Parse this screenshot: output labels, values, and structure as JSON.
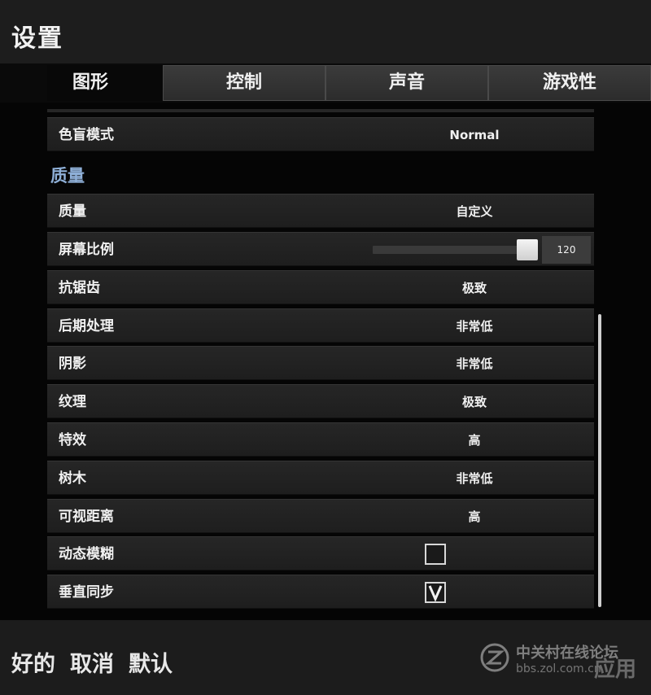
{
  "window": {
    "title": "设置"
  },
  "tabs": [
    {
      "label": "图形",
      "active": true
    },
    {
      "label": "控制",
      "active": false
    },
    {
      "label": "声音",
      "active": false
    },
    {
      "label": "游戏性",
      "active": false
    }
  ],
  "settings": {
    "colorblind": {
      "label": "色盲模式",
      "value": "Normal"
    },
    "quality_section_title": "质量",
    "quality": {
      "label": "质量",
      "value": "自定义"
    },
    "screen_scale": {
      "label": "屏幕比例",
      "value": "120",
      "fill_fraction": 0.93
    },
    "anti_aliasing": {
      "label": "抗锯齿",
      "value": "极致"
    },
    "post_processing": {
      "label": "后期处理",
      "value": "非常低"
    },
    "shadows": {
      "label": "阴影",
      "value": "非常低"
    },
    "textures": {
      "label": "纹理",
      "value": "极致"
    },
    "effects": {
      "label": "特效",
      "value": "高"
    },
    "foliage": {
      "label": "树木",
      "value": "非常低"
    },
    "view_distance": {
      "label": "可视距离",
      "value": "高"
    },
    "motion_blur": {
      "label": "动态模糊",
      "checked": false
    },
    "vsync": {
      "label": "垂直同步",
      "checked": true
    }
  },
  "footer": {
    "ok_label": "好的",
    "cancel_label": "取消",
    "default_label": "默认",
    "apply_label": "应用"
  },
  "watermark": {
    "text": "中关村在线论坛",
    "url": "bbs.zol.com.cn"
  }
}
